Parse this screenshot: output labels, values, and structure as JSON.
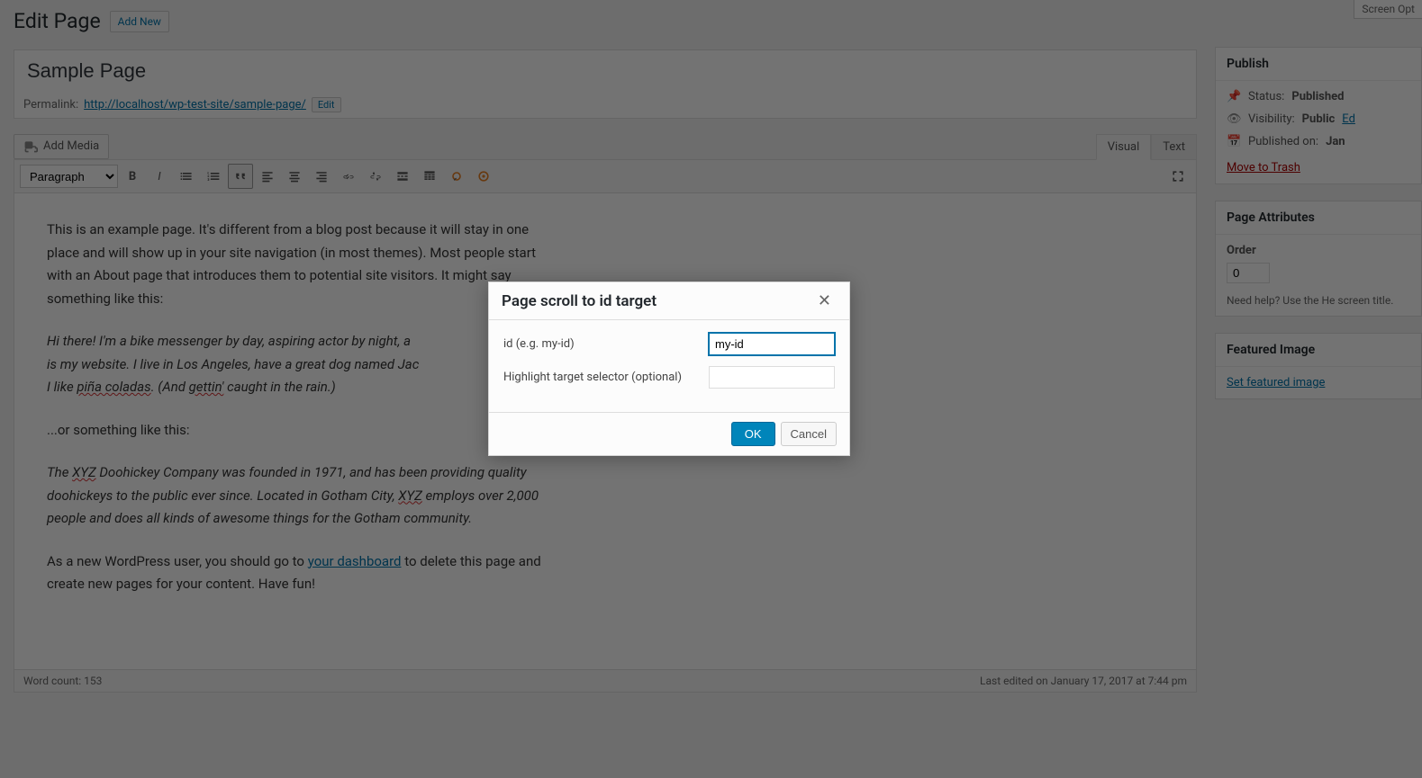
{
  "header": {
    "title": "Edit Page",
    "add_new": "Add New",
    "screen_options": "Screen Opt"
  },
  "post": {
    "title": "Sample Page",
    "permalink_label": "Permalink:",
    "permalink_url": "http://localhost/wp-test-site/sample-page/",
    "edit_label": "Edit"
  },
  "editor": {
    "add_media": "Add Media",
    "tabs": {
      "visual": "Visual",
      "text": "Text"
    },
    "format_select": "Paragraph",
    "content": {
      "p1": "This is an example page. It's different from a blog post because it will stay in one place and will show up in your site navigation (in most themes). Most people start with an About page that introduces them to potential site visitors. It might say something like this:",
      "p2a": "Hi there! I'm a bike messenger by day, aspiring actor by night, a",
      "p2b": "is my website. I live in Los Angeles, have a great dog named Jac",
      "p2c": "I like ",
      "p2c_s": "piña coladas",
      "p2d": ". (And ",
      "p2d_s": "gettin'",
      "p2e": " caught in the rain.)",
      "p3": "...or something like this:",
      "p4a": "The ",
      "p4a_s": "XYZ",
      "p4b": " Doohickey Company was founded in 1971, and has been providing quality doohickeys to the public ever since. Located in Gotham City, ",
      "p4b_s": "XYZ",
      "p4c": " employs over 2,000 people and does all kinds of awesome things for the Gotham community.",
      "p5a": "As a new WordPress user, you should go to ",
      "p5_link": "your dashboard",
      "p5b": " to delete this page and create new pages for your content. Have fun!"
    },
    "footer": {
      "word_count": "Word count: 153",
      "last_edited": "Last edited on January 17, 2017 at 7:44 pm"
    }
  },
  "sidebar": {
    "publish": {
      "title": "Publish",
      "status_label": "Status:",
      "status_value": "Published",
      "visibility_label": "Visibility:",
      "visibility_value": "Public",
      "visibility_edit": "Ed",
      "published_label": "Published on:",
      "published_value": "Jan",
      "trash": "Move to Trash"
    },
    "attributes": {
      "title": "Page Attributes",
      "order_label": "Order",
      "order_value": "0",
      "help_text": "Need help? Use the He screen title."
    },
    "featured": {
      "title": "Featured Image",
      "link": "Set featured image"
    }
  },
  "modal": {
    "title": "Page scroll to id target",
    "id_label": "id (e.g. my-id)",
    "id_value": "my-id",
    "highlight_label": "Highlight target selector (optional)",
    "highlight_value": "",
    "ok": "OK",
    "cancel": "Cancel"
  }
}
